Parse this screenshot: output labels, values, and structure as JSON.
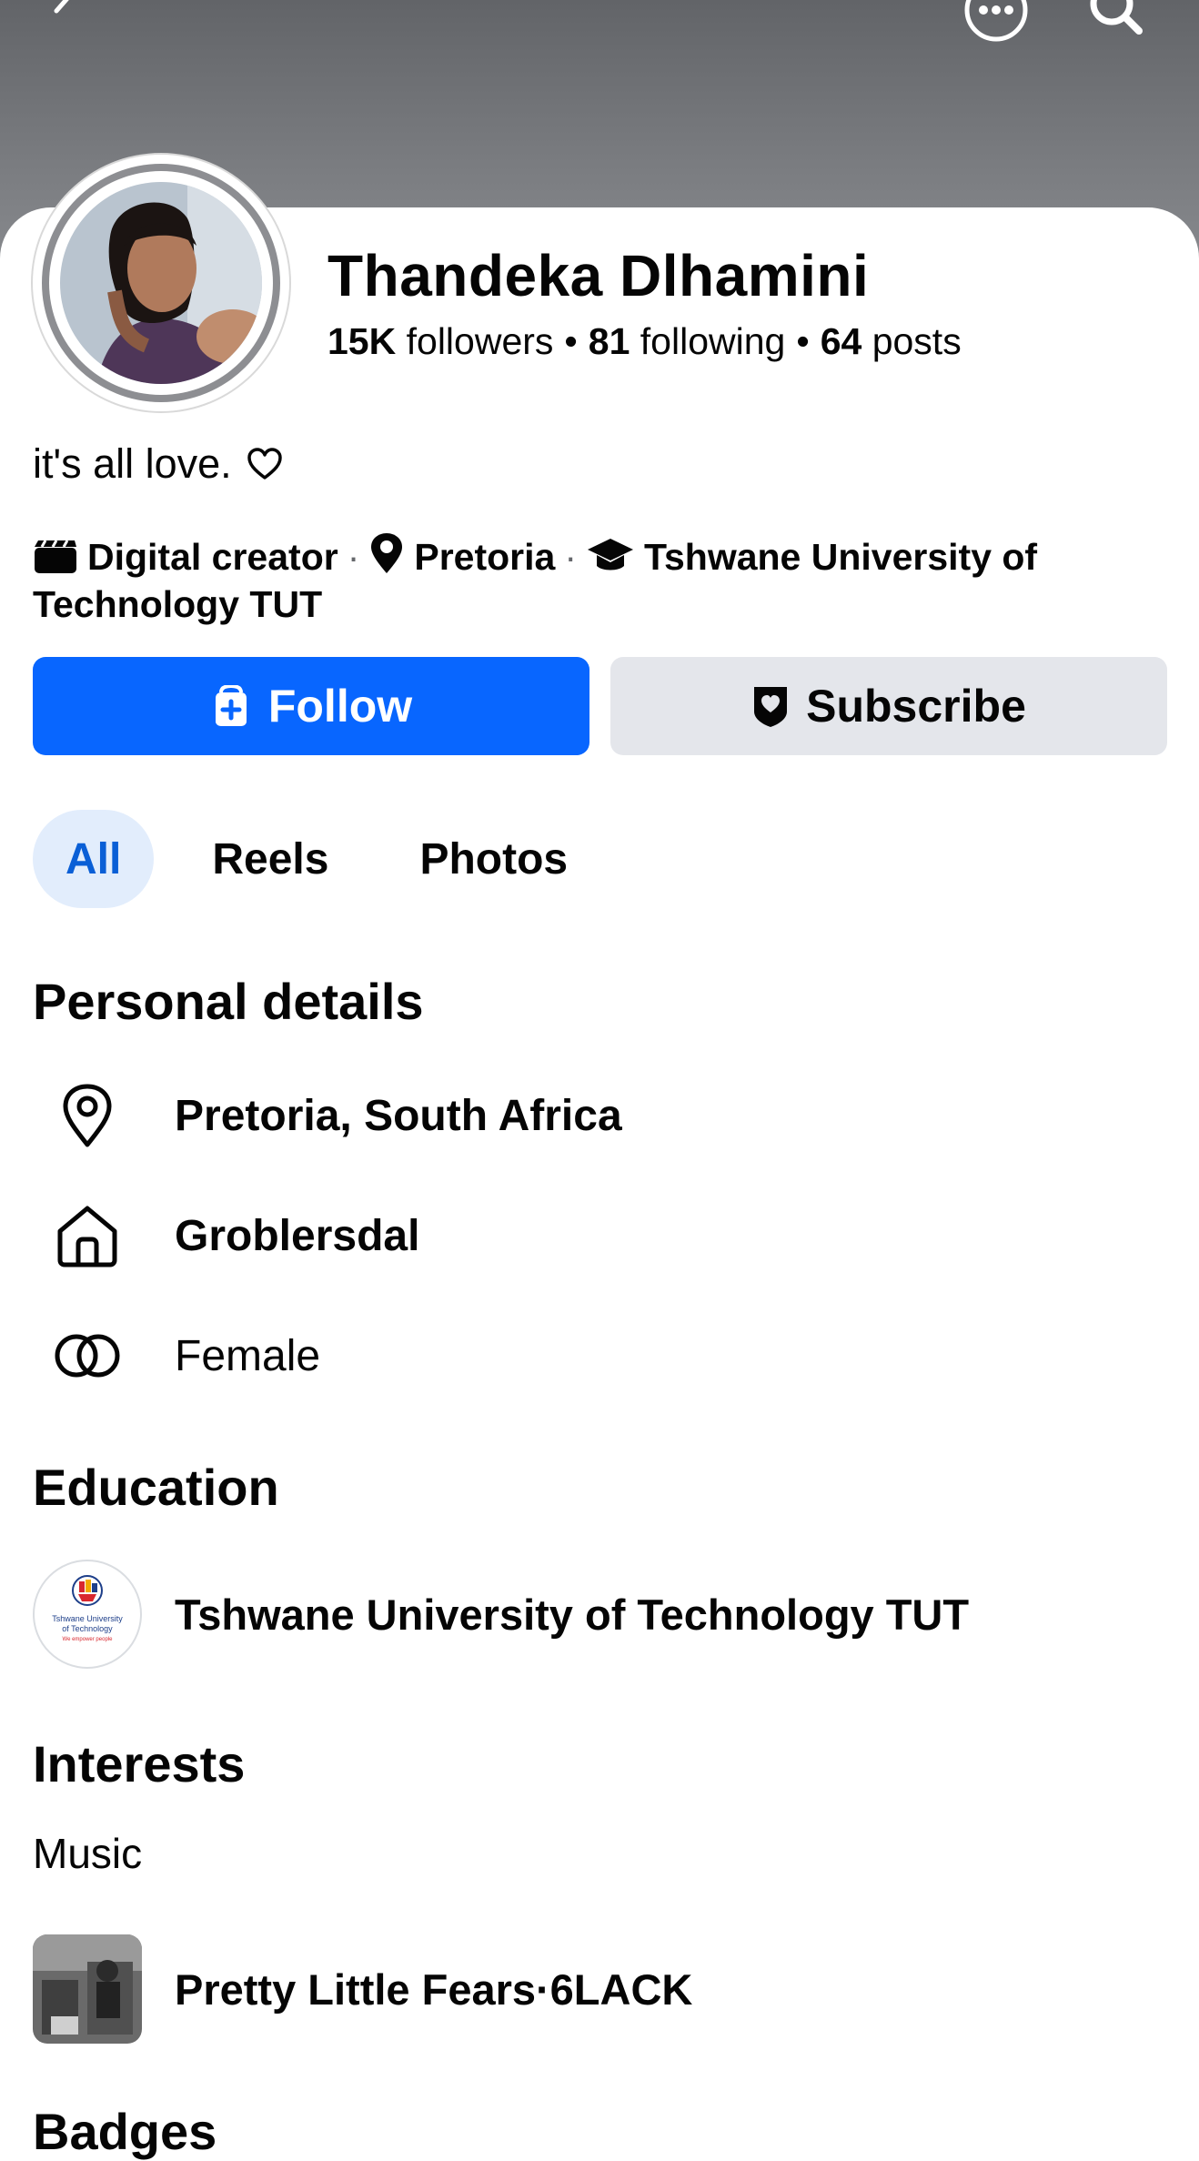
{
  "profile": {
    "name": "Thandeka Dlhamini",
    "followers_count": "15K",
    "followers_label": "followers",
    "following_count": "81",
    "following_label": "following",
    "posts_count": "64",
    "posts_label": "posts",
    "separator": "•",
    "bio": "it's all love."
  },
  "meta": {
    "category": "Digital creator",
    "city": "Pretoria",
    "school": "Tshwane University of Technology TUT",
    "separator": "·"
  },
  "actions": {
    "follow_label": "Follow",
    "subscribe_label": "Subscribe"
  },
  "tabs": [
    {
      "label": "All",
      "active": true
    },
    {
      "label": "Reels",
      "active": false
    },
    {
      "label": "Photos",
      "active": false
    }
  ],
  "personal_details": {
    "title": "Personal details",
    "current_city": "Pretoria, South Africa",
    "hometown": "Groblersdal",
    "gender": "Female"
  },
  "education": {
    "title": "Education",
    "school": "Tshwane University of Technology TUT",
    "logo_text_1": "Tshwane University",
    "logo_text_2": "of Technology",
    "logo_text_3": "We empower people"
  },
  "interests": {
    "title": "Interests",
    "category": "Music",
    "item": "Pretty Little Fears·6LACK"
  },
  "badges": {
    "title": "Badges"
  },
  "colors": {
    "accent": "#0866ff",
    "tab_active_bg": "#e2edfc",
    "tab_active_text": "#0a5fd6",
    "button_secondary": "#e4e6eb"
  },
  "icons": {
    "back": "chevron-left-icon",
    "more": "more-horizontal-icon",
    "search": "search-icon",
    "heart": "heart-outline-icon",
    "category": "clapperboard-icon",
    "location": "pin-icon",
    "school": "graduation-cap-icon",
    "follow": "add-friend-icon",
    "subscribe": "badge-heart-icon",
    "home": "home-icon",
    "gender": "gender-rings-icon"
  }
}
